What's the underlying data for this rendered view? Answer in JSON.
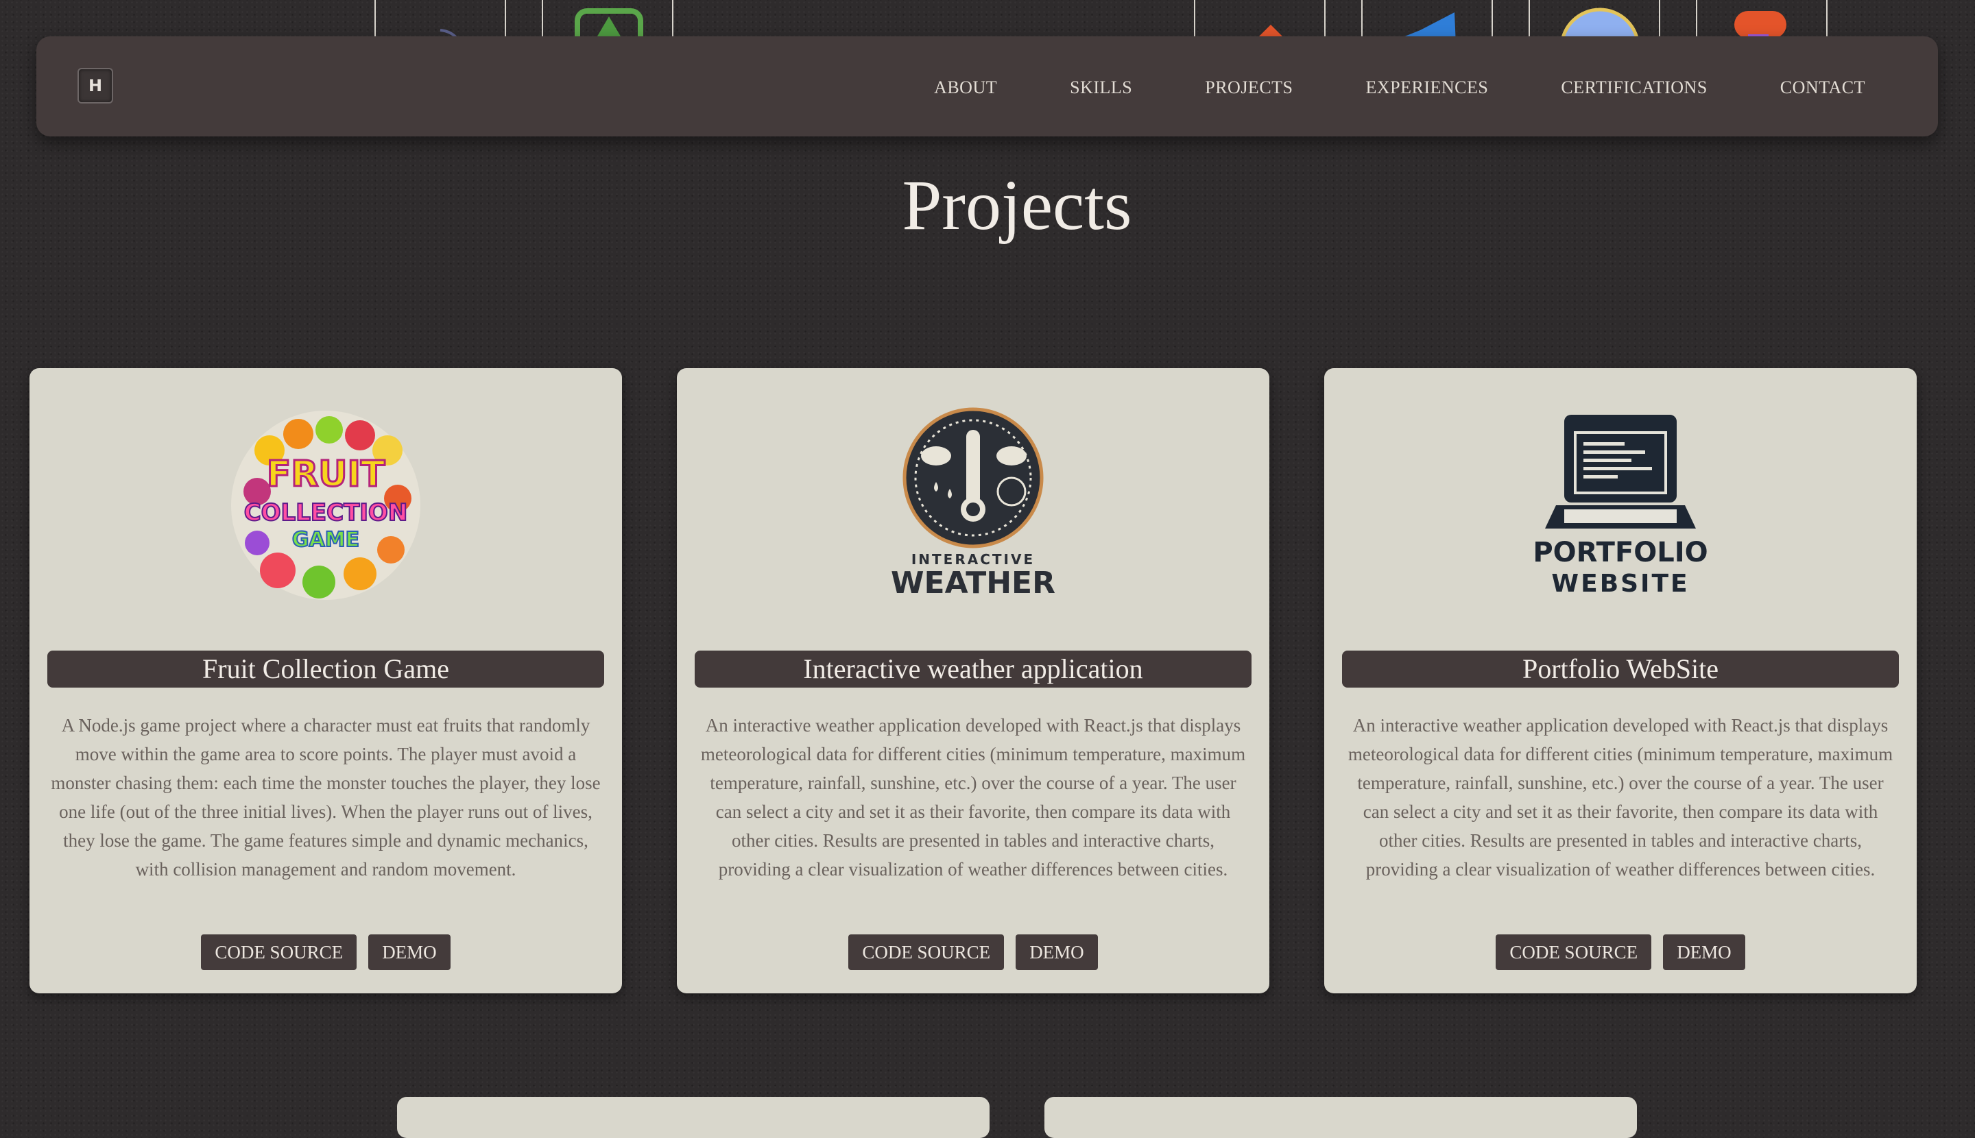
{
  "nav": {
    "logo_letter": "H",
    "links": [
      "ABOUT",
      "SKILLS",
      "PROJECTS",
      "EXPERIENCES",
      "CERTIFICATIONS",
      "CONTACT"
    ]
  },
  "skills_strip": {
    "icons": [
      "javascript-icon",
      "nodejs-icon",
      "git-icon",
      "vscode-icon",
      "circle-logo-icon",
      "figma-icon"
    ]
  },
  "projects": {
    "title": "Projects",
    "cards": [
      {
        "image_icon": "fruit-collection-game-logo",
        "image_text": [
          "FRUIT",
          "COLLECTION",
          "GAME"
        ],
        "title": "Fruit Collection Game",
        "description": "A Node.js game project where a character must eat fruits that randomly move within the game area to score points. The player must avoid a monster chasing them: each time the monster touches the player, they lose one life (out of the three initial lives). When the player runs out of lives, they lose the game. The game features simple and dynamic mechanics, with collision management and random movement.",
        "code_label": "CODE SOURCE",
        "demo_label": "DEMO"
      },
      {
        "image_icon": "interactive-weather-logo",
        "image_text": [
          "INTERACTIVE",
          "WEATHER"
        ],
        "title": "Interactive weather application",
        "description": "An interactive weather application developed with React.js that displays meteorological data for different cities (minimum temperature, maximum temperature, rainfall, sunshine, etc.) over the course of a year. The user can select a city and set it as their favorite, then compare its data with other cities. Results are presented in tables and interactive charts, providing a clear visualization of weather differences between cities.",
        "code_label": "CODE SOURCE",
        "demo_label": "DEMO"
      },
      {
        "image_icon": "portfolio-website-logo",
        "image_text": [
          "PORTFOLIO",
          "WEBSITE"
        ],
        "title": "Portfolio WebSite",
        "description": "An interactive weather application developed with React.js that displays meteorological data for different cities (minimum temperature, maximum temperature, rainfall, sunshine, etc.) over the course of a year. The user can select a city and set it as their favorite, then compare its data with other cities. Results are presented in tables and interactive charts, providing a clear visualization of weather differences between cities.",
        "code_label": "CODE SOURCE",
        "demo_label": "DEMO"
      }
    ]
  },
  "colors": {
    "background": "#2e2b2c",
    "navbar": "#443b3b",
    "card": "#d9d7cc",
    "button": "#443b3b",
    "text_light": "#f1ece6",
    "text_muted": "#6a625d"
  }
}
